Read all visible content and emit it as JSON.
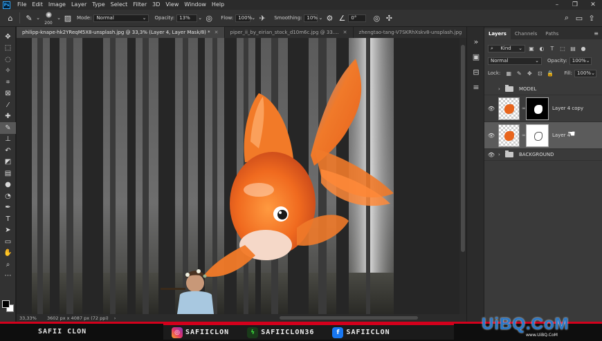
{
  "menu": [
    "File",
    "Edit",
    "Image",
    "Layer",
    "Type",
    "Select",
    "Filter",
    "3D",
    "View",
    "Window",
    "Help"
  ],
  "options": {
    "brush_size": "200",
    "mode_label": "Mode:",
    "mode_value": "Normal",
    "opacity_label": "Opacity:",
    "opacity_value": "13%",
    "flow_label": "Flow:",
    "flow_value": "100%",
    "smoothing_label": "Smoothing:",
    "smoothing_value": "10%",
    "angle_value": "0°"
  },
  "tabs": [
    {
      "label": "philipp-knape-hk2YReqM5X8-unsplash.jpg @ 33,3% (Layer 4, Layer Mask/8) *"
    },
    {
      "label": "piper_ii_by_eirian_stock_d10m6c.jpg @ 33...."
    },
    {
      "label": "zhengtao-tang-V7SKRhXskv8-unsplash.jpg"
    }
  ],
  "status": {
    "zoom": "33,33%",
    "doc": "3602 px x 4087 px (72 ppi)"
  },
  "panel": {
    "tabs": [
      "Layers",
      "Channels",
      "Paths"
    ],
    "kind": "Kind",
    "blend": "Normal",
    "opacity_label": "Opacity:",
    "opacity_value": "100%",
    "lock_label": "Lock:",
    "fill_label": "Fill:",
    "fill_value": "100%"
  },
  "layers": [
    {
      "name": "MODEL",
      "type": "group"
    },
    {
      "name": "Layer 4 copy",
      "type": "layer",
      "mask": "black"
    },
    {
      "name": "Layer 4",
      "type": "layer",
      "mask": "white",
      "selected": true
    },
    {
      "name": "BACKGROUND",
      "type": "group"
    }
  ],
  "banner": {
    "brand": "SAFII CLON",
    "instagram": "SAFIICLON",
    "other": "SAFIICLON36",
    "facebook": "SAFIICLON"
  },
  "watermark": {
    "text": "UiBQ.CoM",
    "sub": "www.UiBQ.CoM"
  },
  "colors": {
    "red": "#d4001c",
    "fish": "#f06a1f",
    "fin_blue": "#6a8fd8"
  }
}
